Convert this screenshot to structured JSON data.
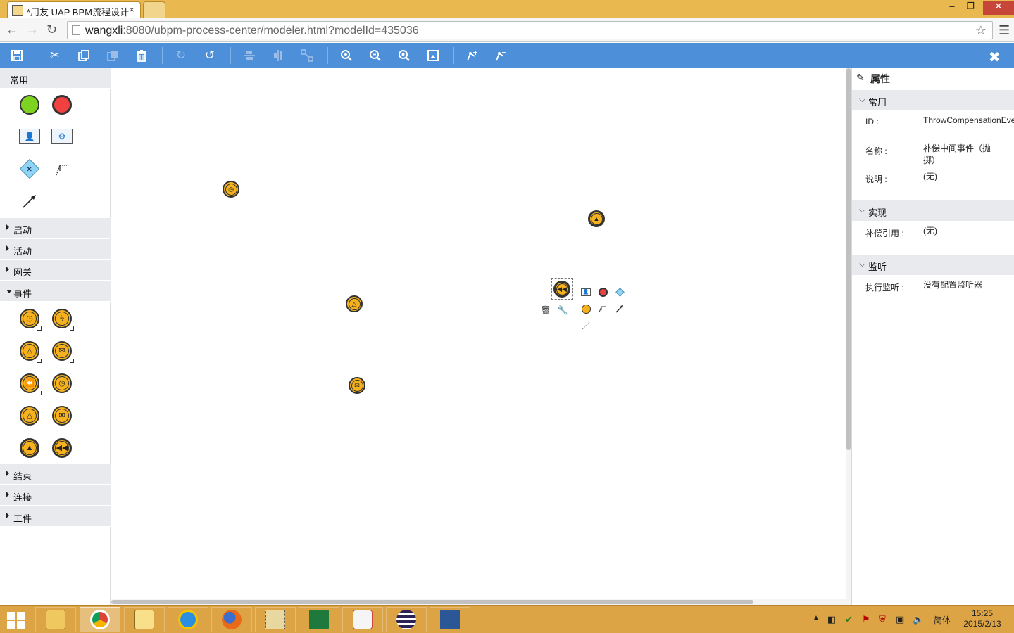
{
  "browser": {
    "tab_title": "*用友 UAP BPM流程设计",
    "tab_close": "×",
    "url_host": "wangxli",
    "url_rest": ":8080/ubpm-process-center/modeler.html?modelId=435036",
    "window_controls": {
      "minimize": "–",
      "maximize": "❐",
      "close": "✕"
    }
  },
  "toolbar": {
    "buttons": [
      {
        "icon": "save-icon",
        "enabled": true
      },
      {
        "icon": "cut-icon",
        "enabled": true
      },
      {
        "icon": "copy-icon",
        "enabled": true
      },
      {
        "icon": "paste-icon",
        "enabled": false
      },
      {
        "icon": "delete-icon",
        "enabled": true
      },
      {
        "icon": "redo-icon",
        "enabled": false
      },
      {
        "icon": "undo-icon",
        "enabled": true
      },
      {
        "icon": "align-vertical-icon",
        "enabled": false
      },
      {
        "icon": "align-horizontal-icon",
        "enabled": false
      },
      {
        "icon": "same-size-icon",
        "enabled": false
      },
      {
        "icon": "zoom-in-icon",
        "enabled": true
      },
      {
        "icon": "zoom-out-icon",
        "enabled": true
      },
      {
        "icon": "zoom-actual-icon",
        "enabled": true
      },
      {
        "icon": "zoom-fit-icon",
        "enabled": true
      },
      {
        "icon": "add-bendpoint-icon",
        "enabled": true
      },
      {
        "icon": "remove-bendpoint-icon",
        "enabled": true
      }
    ],
    "close": "✖"
  },
  "palette": {
    "common_label": "常用",
    "groups": {
      "start": "启动",
      "activity": "活动",
      "gateway": "网关",
      "event": "事件",
      "end": "结束",
      "connection": "连接",
      "artifact": "工件"
    }
  },
  "properties": {
    "title": "属性",
    "sections": {
      "common": "常用",
      "implementation": "实现",
      "listener": "监听"
    },
    "rows": {
      "id_key": "ID :",
      "id_value": "ThrowCompensationEvent...",
      "name_key": "名称 :",
      "name_value": "补偿中间事件（抛掷）",
      "desc_key": "说明 :",
      "desc_value": "(无)",
      "comp_ref_key": "补偿引用 :",
      "comp_ref_value": "(无)",
      "exec_listener_key": "执行监听 :",
      "exec_listener_value": "没有配置监听器"
    }
  },
  "taskbar": {
    "ime": "简体",
    "time": "15:25",
    "date": "2015/2/13"
  },
  "colors": {
    "toolbar_bg": "#4e8fda",
    "event_fill": "#f5b21e",
    "start_event": "#7ed321",
    "end_event": "#f04040",
    "titlebar": "#e9b84e"
  }
}
